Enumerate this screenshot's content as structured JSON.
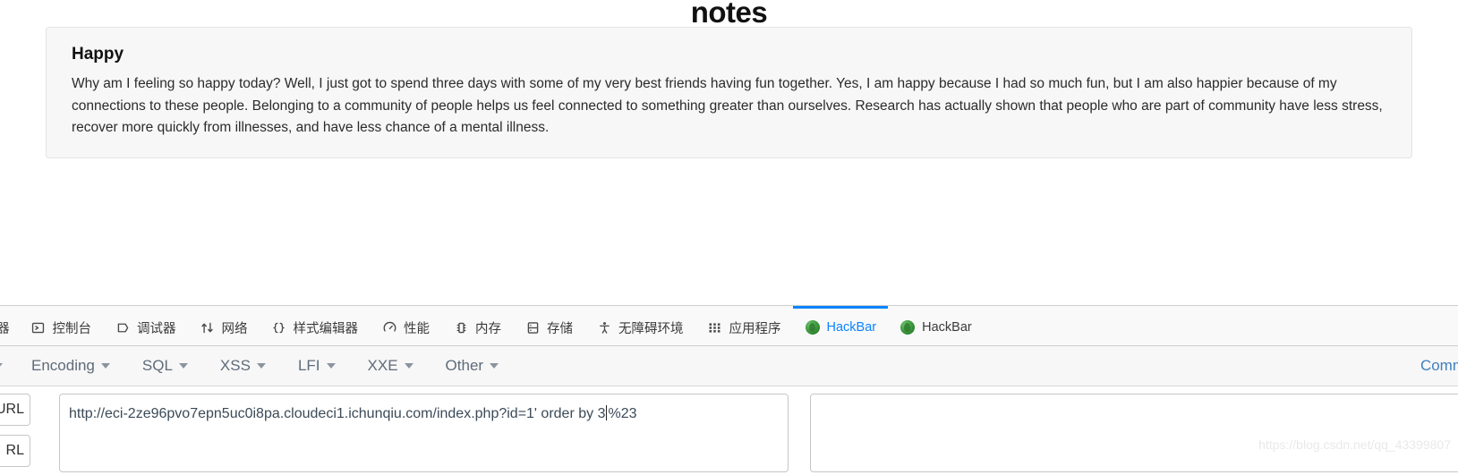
{
  "page": {
    "title": "notes",
    "note": {
      "heading": "Happy",
      "body": "Why am I feeling so happy today? Well, I just got to spend three days with some of my very best friends having fun together. Yes, I am happy because I had so much fun, but I am also happier because of my connections to these people. Belonging to a community of people helps us feel connected to something greater than ourselves. Research has actually shown that people who are part of community have less stress, recover more quickly from illnesses, and have less chance of a mental illness."
    }
  },
  "devtools": {
    "tabs": [
      {
        "label": "器",
        "icon": "inspector-icon",
        "active": false,
        "cut": true
      },
      {
        "label": "控制台",
        "icon": "console-icon",
        "active": false
      },
      {
        "label": "调试器",
        "icon": "debugger-icon",
        "active": false
      },
      {
        "label": "网络",
        "icon": "network-icon",
        "active": false
      },
      {
        "label": "样式编辑器",
        "icon": "style-editor-icon",
        "active": false
      },
      {
        "label": "性能",
        "icon": "performance-icon",
        "active": false
      },
      {
        "label": "内存",
        "icon": "memory-icon",
        "active": false
      },
      {
        "label": "存储",
        "icon": "storage-icon",
        "active": false
      },
      {
        "label": "无障碍环境",
        "icon": "accessibility-icon",
        "active": false
      },
      {
        "label": "应用程序",
        "icon": "application-icon",
        "active": false
      },
      {
        "label": "HackBar",
        "icon": "hackbar-bug-icon",
        "active": true
      },
      {
        "label": "HackBar",
        "icon": "hackbar-bug-icon",
        "active": false
      }
    ],
    "active_tab_color": "#0a84ff"
  },
  "hackbar": {
    "menus": [
      {
        "label": "",
        "cut": true
      },
      {
        "label": "Encoding"
      },
      {
        "label": "SQL"
      },
      {
        "label": "XSS"
      },
      {
        "label": "LFI"
      },
      {
        "label": "XXE"
      },
      {
        "label": "Other"
      }
    ],
    "right_link": "Comm",
    "side_buttons": [
      {
        "label": "URL"
      },
      {
        "label": "RL"
      }
    ],
    "url_value": "http://eci-2ze96pvo7epn5uc0i8pa.cloudeci1.ichunqiu.com/index.php?id=1' order by 3",
    "url_value_after_caret": "%23"
  },
  "watermark": "https://blog.csdn.net/qq_43399807"
}
